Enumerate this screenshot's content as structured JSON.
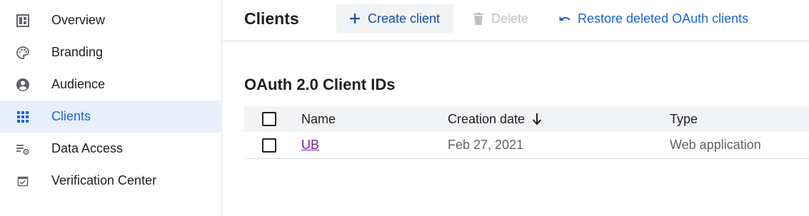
{
  "sidebar": {
    "items": [
      {
        "label": "Overview",
        "icon": "dashboard-icon"
      },
      {
        "label": "Branding",
        "icon": "palette-icon"
      },
      {
        "label": "Audience",
        "icon": "account-circle-icon"
      },
      {
        "label": "Clients",
        "icon": "apps-grid-icon",
        "active": true
      },
      {
        "label": "Data Access",
        "icon": "data-settings-icon"
      },
      {
        "label": "Verification Center",
        "icon": "checkbox-calendar-icon"
      }
    ]
  },
  "header": {
    "title": "Clients",
    "create_label": "Create client",
    "delete_label": "Delete",
    "restore_label": "Restore deleted OAuth clients"
  },
  "section": {
    "title": "OAuth 2.0 Client IDs"
  },
  "table": {
    "columns": {
      "name": "Name",
      "creation_date": "Creation date",
      "type": "Type"
    },
    "rows": [
      {
        "name": "UB",
        "creation_date": "Feb 27, 2021",
        "type": "Web application"
      }
    ]
  },
  "colors": {
    "accent": "#1967d2",
    "active_bg": "#e8f0fe",
    "disabled": "#bdc1c6",
    "visited_link": "#7b1fa2"
  }
}
